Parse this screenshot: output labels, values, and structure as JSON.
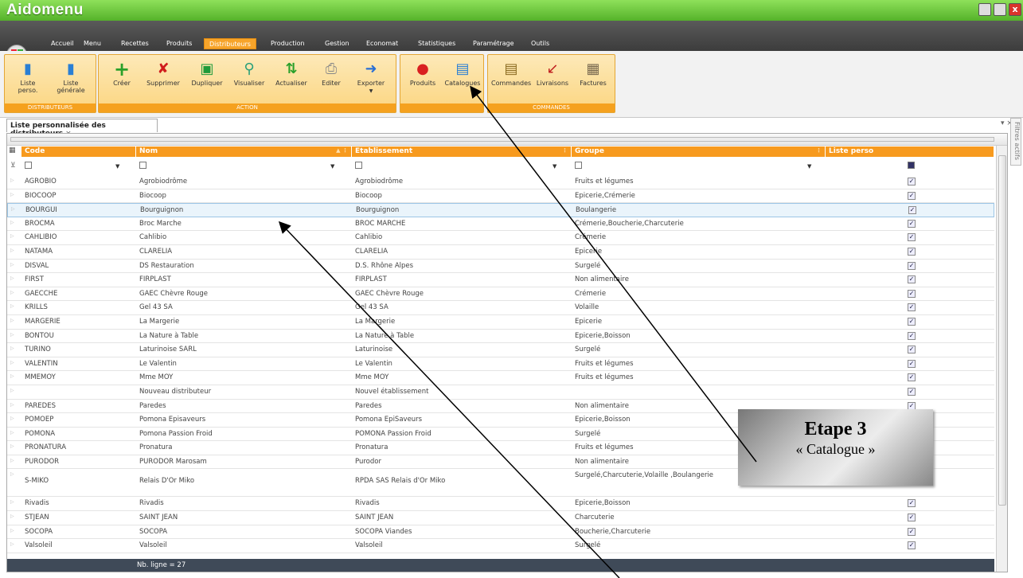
{
  "window": {
    "title": "Aidomenu"
  },
  "menu": {
    "tabs": [
      "Accueil",
      "Menu",
      "Recettes",
      "Produits",
      "Distributeurs",
      "Production",
      "Gestion",
      "Economat",
      "Statistiques",
      "Paramétrage",
      "Outils"
    ],
    "active": "Distributeurs"
  },
  "ribbon": {
    "groups": {
      "distributeurs": {
        "label": "DISTRIBUTEURS",
        "buttons": [
          "Liste perso.",
          "Liste générale"
        ]
      },
      "action": {
        "label": "ACTION",
        "buttons": [
          "Créer",
          "Supprimer",
          "Dupliquer",
          "Visualiser",
          "Actualiser",
          "Editer",
          "Exporter"
        ]
      },
      "catalogue": {
        "label": "",
        "buttons": [
          "Produits",
          "Catalogues"
        ]
      },
      "commandes": {
        "label": "COMMANDES",
        "buttons": [
          "Commandes",
          "Livraisons",
          "Factures"
        ]
      }
    }
  },
  "document_tab": {
    "label": "Liste personnalisée des distributeurs",
    "close": "×"
  },
  "side_panel": {
    "label": "Filtres actifs"
  },
  "grid": {
    "headers": {
      "code": "Code",
      "nom": "Nom",
      "etablissement": "Etablissement",
      "groupe": "Groupe",
      "liste_perso": "Liste perso"
    },
    "rows": [
      {
        "code": "AGROBIO",
        "nom": "Agrobiodrôme",
        "etab": "Agrobiodrôme",
        "groupe": "Fruits et légumes"
      },
      {
        "code": "BIOCOOP",
        "nom": "Biocoop",
        "etab": "Biocoop",
        "groupe": "Epicerie,Crémerie"
      },
      {
        "code": "BOURGUI",
        "nom": "Bourguignon",
        "etab": "Bourguignon",
        "groupe": "Boulangerie"
      },
      {
        "code": "BROCMA",
        "nom": "Broc Marche",
        "etab": "BROC MARCHE",
        "groupe": "Crémerie,Boucherie,Charcuterie"
      },
      {
        "code": "CAHLIBIO",
        "nom": "Cahlibio",
        "etab": "Cahlibio",
        "groupe": "Crémerie"
      },
      {
        "code": "NATAMA",
        "nom": "CLARELIA",
        "etab": "CLARELIA",
        "groupe": "Epicerie"
      },
      {
        "code": "DISVAL",
        "nom": "DS Restauration",
        "etab": "D.S. Rhône Alpes",
        "groupe": "Surgelé"
      },
      {
        "code": "FIRST",
        "nom": "FIRPLAST",
        "etab": "FIRPLAST",
        "groupe": "Non alimentaire"
      },
      {
        "code": "GAECCHE",
        "nom": "GAEC Chèvre Rouge",
        "etab": "GAEC Chèvre Rouge",
        "groupe": "Crémerie"
      },
      {
        "code": "KRILLS",
        "nom": "Gel 43 SA",
        "etab": "Gel 43 SA",
        "groupe": "Volaille"
      },
      {
        "code": "MARGERIE",
        "nom": "La Margerie",
        "etab": "La Margerie",
        "groupe": "Epicerie"
      },
      {
        "code": "BONTOU",
        "nom": "La Nature à Table",
        "etab": "La Nature à Table",
        "groupe": "Epicerie,Boisson"
      },
      {
        "code": "TURINO",
        "nom": "Laturinoise SARL",
        "etab": "Laturinoise",
        "groupe": "Surgelé"
      },
      {
        "code": "VALENTIN",
        "nom": "Le Valentin",
        "etab": "Le Valentin",
        "groupe": "Fruits et légumes"
      },
      {
        "code": "MMEMOY",
        "nom": "Mme MOY",
        "etab": "Mme MOY",
        "groupe": "Fruits et légumes"
      },
      {
        "code": "",
        "nom": "Nouveau distributeur",
        "etab": "Nouvel établissement",
        "groupe": ""
      },
      {
        "code": "PAREDES",
        "nom": "Paredes",
        "etab": "Paredes",
        "groupe": "Non alimentaire"
      },
      {
        "code": "POMOEP",
        "nom": "Pomona Episaveurs",
        "etab": "Pomona EpiSaveurs",
        "groupe": "Epicerie,Boisson"
      },
      {
        "code": "POMONA",
        "nom": "Pomona Passion Froid",
        "etab": "POMONA Passion Froid",
        "groupe": "Surgelé"
      },
      {
        "code": "PRONATURA",
        "nom": "Pronatura",
        "etab": "Pronatura",
        "groupe": "Fruits et légumes"
      },
      {
        "code": "PURODOR",
        "nom": "PURODOR Marosam",
        "etab": "Purodor",
        "groupe": "Non alimentaire"
      },
      {
        "code": "S-MIKO",
        "nom": "Relais D'Or Miko",
        "etab": "RPDA SAS Relais d'Or Miko",
        "groupe": "Surgelé,Charcuterie,Volaille ,Boulangerie"
      },
      {
        "code": "Rivadis",
        "nom": "Rivadis",
        "etab": "Rivadis",
        "groupe": "Epicerie,Boisson"
      },
      {
        "code": "STJEAN",
        "nom": "SAINT JEAN",
        "etab": "SAINT JEAN",
        "groupe": "Charcuterie"
      },
      {
        "code": "SOCOPA",
        "nom": "SOCOPA",
        "etab": "SOCOPA Viandes",
        "groupe": "Boucherie,Charcuterie"
      },
      {
        "code": "Valsoleil",
        "nom": "Valsoleil",
        "etab": "Valsoleil",
        "groupe": "Surgelé"
      }
    ],
    "footer": "Nb. ligne = 27"
  },
  "callout": {
    "title": "Etape 3",
    "subtitle": "« Catalogue »"
  }
}
